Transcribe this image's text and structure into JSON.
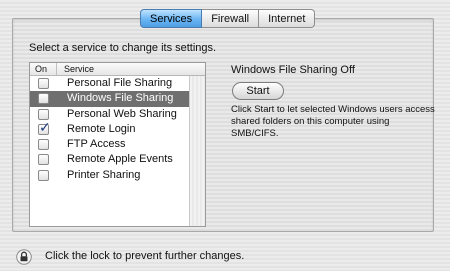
{
  "tabs": [
    {
      "label": "Services",
      "active": true
    },
    {
      "label": "Firewall",
      "active": false
    },
    {
      "label": "Internet",
      "active": false
    }
  ],
  "instruction": "Select a service to change its settings.",
  "list": {
    "header_on": "On",
    "header_service": "Service",
    "rows": [
      {
        "label": "Personal File Sharing",
        "checked": false,
        "selected": false
      },
      {
        "label": "Windows File Sharing",
        "checked": false,
        "selected": true
      },
      {
        "label": "Personal Web Sharing",
        "checked": false,
        "selected": false
      },
      {
        "label": "Remote Login",
        "checked": true,
        "selected": false
      },
      {
        "label": "FTP Access",
        "checked": false,
        "selected": false
      },
      {
        "label": "Remote Apple Events",
        "checked": false,
        "selected": false
      },
      {
        "label": "Printer Sharing",
        "checked": false,
        "selected": false
      }
    ]
  },
  "detail": {
    "status": "Windows File Sharing Off",
    "start_label": "Start",
    "description": "Click Start to let selected Windows users access shared folders on this computer using SMB/CIFS."
  },
  "footer": {
    "lock_icon": "lock-icon",
    "lock_text": "Click the lock to prevent further changes."
  }
}
